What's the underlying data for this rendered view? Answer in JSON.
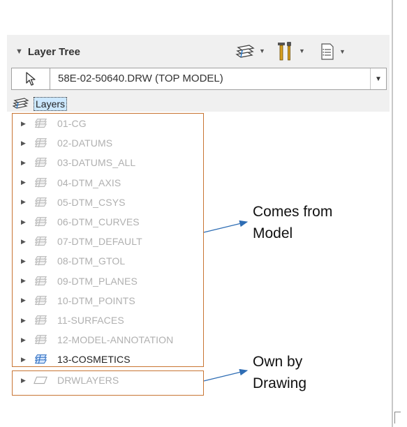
{
  "panel": {
    "title": "Layer Tree",
    "toolbar": {
      "layers_icon": "layers-icon",
      "tools_icon": "tools-icon",
      "list_icon": "list-icon"
    }
  },
  "model_select": {
    "value": "58E-02-50640.DRW (TOP MODEL)"
  },
  "tree": {
    "root_label": "Layers",
    "items": [
      {
        "label": "01-CG",
        "active": false
      },
      {
        "label": "02-DATUMS",
        "active": false
      },
      {
        "label": "03-DATUMS_ALL",
        "active": false
      },
      {
        "label": "04-DTM_AXIS",
        "active": false
      },
      {
        "label": "05-DTM_CSYS",
        "active": false
      },
      {
        "label": "06-DTM_CURVES",
        "active": false
      },
      {
        "label": "07-DTM_DEFAULT",
        "active": false
      },
      {
        "label": "08-DTM_GTOL",
        "active": false
      },
      {
        "label": "09-DTM_PLANES",
        "active": false
      },
      {
        "label": "10-DTM_POINTS",
        "active": false
      },
      {
        "label": "11-SURFACES",
        "active": false
      },
      {
        "label": "12-MODEL-ANNOTATION",
        "active": false
      },
      {
        "label": "13-COSMETICS",
        "active": true
      }
    ],
    "drawing_layer": {
      "label": "DRWLAYERS"
    }
  },
  "annotations": {
    "model_note": [
      "Comes from",
      "Model"
    ],
    "drawing_note": [
      "Own by",
      "Drawing"
    ],
    "box_color": "#c87533",
    "arrow_color": "#2e6db4"
  }
}
